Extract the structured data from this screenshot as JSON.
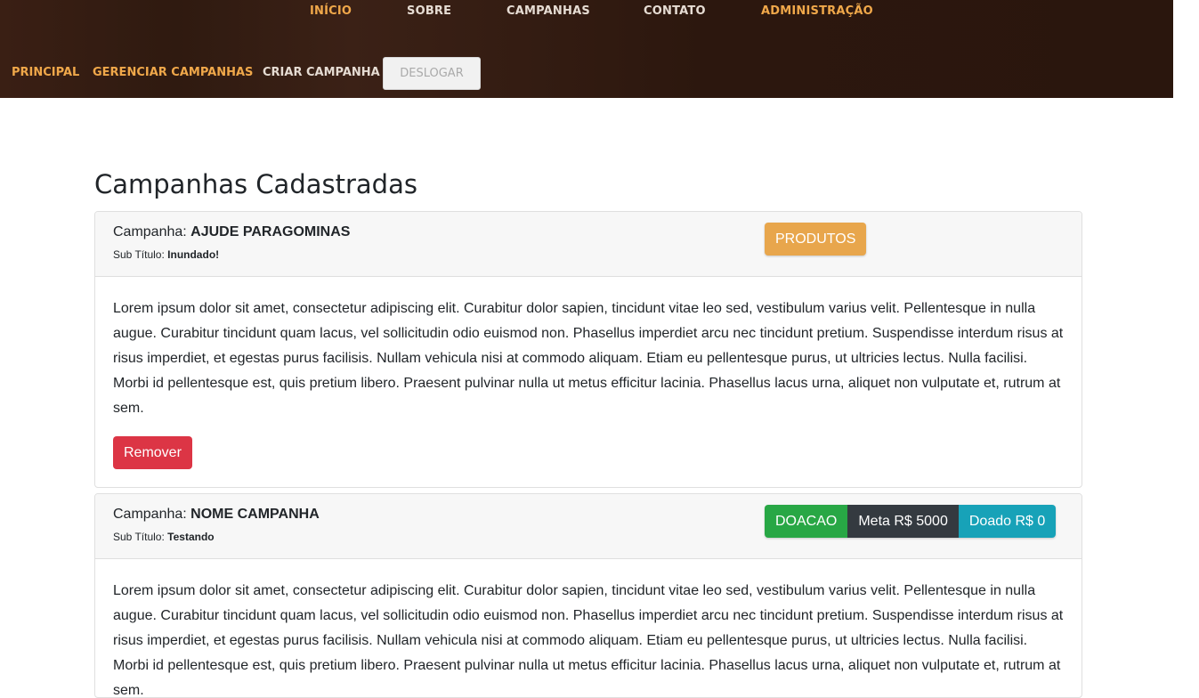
{
  "nav": {
    "items": [
      {
        "label": "INÍCIO"
      },
      {
        "label": "SOBRE"
      },
      {
        "label": "CAMPANHAS"
      },
      {
        "label": "CONTATO"
      },
      {
        "label": "ADMINISTRAÇÃO"
      }
    ]
  },
  "subnav": {
    "items": [
      {
        "label": "PRINCIPAL"
      },
      {
        "label": "GERENCIAR CAMPANHAS"
      },
      {
        "label": "CRIAR CAMPANHA"
      }
    ],
    "logout_label": "DESLOGAR"
  },
  "page": {
    "title": "Campanhas Cadastradas"
  },
  "campaigns": [
    {
      "campaign_label": "Campanha: ",
      "name": "AJUDE PARAGOMINAS",
      "subtitle_label": "Sub Título: ",
      "subtitle": "Inundado!",
      "type_badge": "PRODUTOS",
      "description": "Lorem ipsum dolor sit amet, consectetur adipiscing elit. Curabitur dolor sapien, tincidunt vitae leo sed, vestibulum varius velit. Pellentesque in nulla augue. Curabitur tincidunt quam lacus, vel sollicitudin odio euismod non. Phasellus imperdiet arcu nec tincidunt pretium. Suspendisse interdum risus at risus imperdiet, et egestas purus facilisis. Nullam vehicula nisi at commodo aliquam. Etiam eu pellentesque purus, ut ultricies lectus. Nulla facilisi. Morbi id pellentesque est, quis pretium libero. Praesent pulvinar nulla ut metus efficitur lacinia. Phasellus lacus urna, aliquet non vulputate et, rutrum at sem.",
      "remove_label": "Remover"
    },
    {
      "campaign_label": "Campanha: ",
      "name": "NOME CAMPANHA",
      "subtitle_label": "Sub Título: ",
      "subtitle": "Testando",
      "type_badge": "DOACAO",
      "goal_badge": "Meta R$ 5000",
      "donated_badge": "Doado R$ 0",
      "description": "Lorem ipsum dolor sit amet, consectetur adipiscing elit. Curabitur dolor sapien, tincidunt vitae leo sed, vestibulum varius velit. Pellentesque in nulla augue. Curabitur tincidunt quam lacus, vel sollicitudin odio euismod non. Phasellus imperdiet arcu nec tincidunt pretium. Suspendisse interdum risus at risus imperdiet, et egestas purus facilisis. Nullam vehicula nisi at commodo aliquam. Etiam eu pellentesque purus, ut ultricies lectus. Nulla facilisi. Morbi id pellentesque est, quis pretium libero. Praesent pulvinar nulla ut metus efficitur lacinia. Phasellus lacus urna, aliquet non vulputate et, rutrum at sem."
    }
  ],
  "colors": {
    "header_bg": "#2f1a10",
    "nav_accent": "#f0a84a",
    "nav_light": "#e6dcd3",
    "remove_button": "#dc3545",
    "badge_produtos": "#e8a64c",
    "badge_doacao": "#28a745",
    "badge_meta": "#343a40",
    "badge_doado": "#17a2b8"
  }
}
